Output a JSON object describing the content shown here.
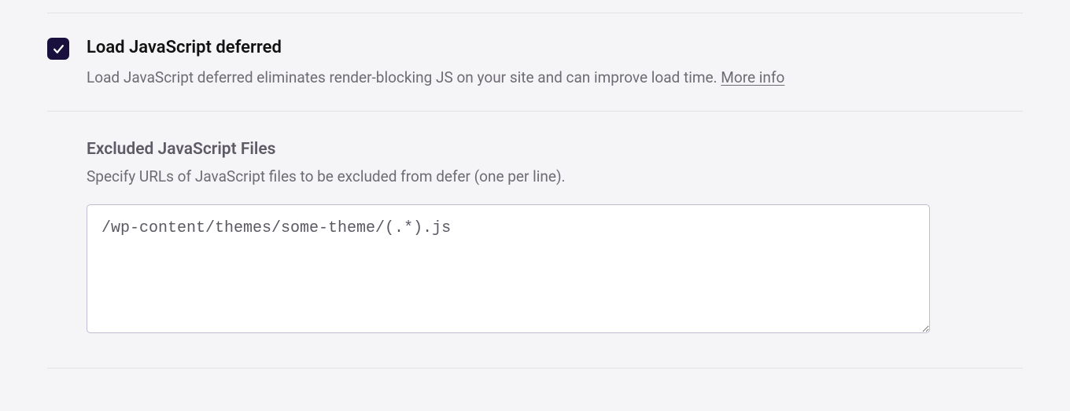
{
  "option": {
    "title": "Load JavaScript deferred",
    "description": "Load JavaScript deferred eliminates render-blocking JS on your site and can improve load time. ",
    "more_info_label": "More info",
    "checked": true
  },
  "excluded": {
    "title": "Excluded JavaScript Files",
    "description": "Specify URLs of JavaScript files to be excluded from defer (one per line).",
    "value": "/wp-content/themes/some-theme/(.*).js"
  }
}
